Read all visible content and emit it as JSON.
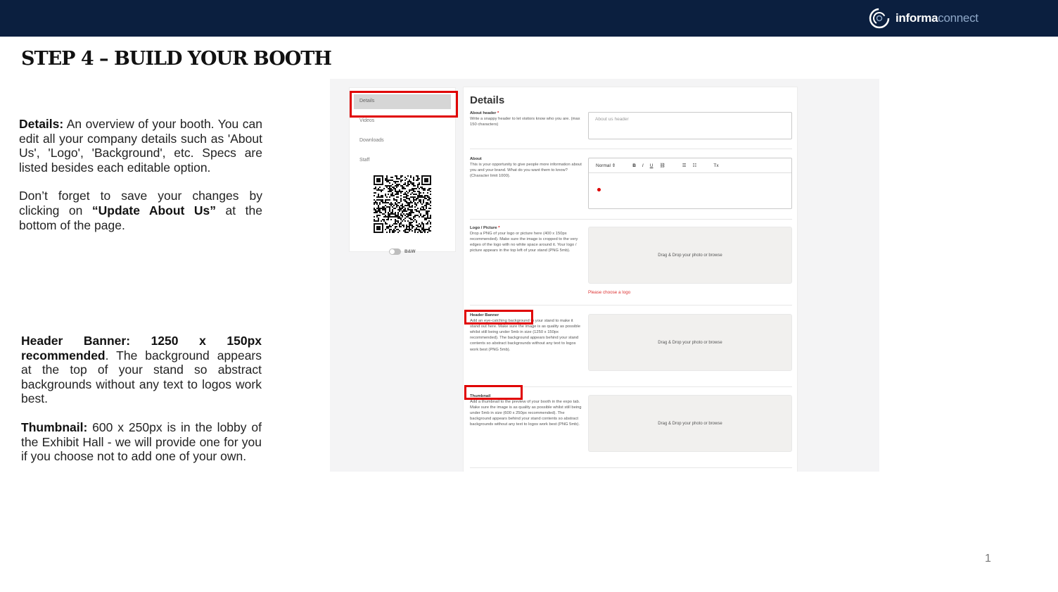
{
  "header": {
    "logo_primary": "informa",
    "logo_secondary": "connect",
    "bar_color": "#0b1f3f"
  },
  "slide": {
    "title": "STEP 4 – BUILD YOUR BOOTH",
    "page_number": "1"
  },
  "descriptions": {
    "details_label": "Details:",
    "details_text": " An overview of your booth. You can edit all your company details such as 'About Us', 'Logo', 'Background', etc. Specs are listed besides each editable option.",
    "save_pre": "Don’t forget to save your changes by clicking on ",
    "save_bold": "“Update About Us”",
    "save_post": " at the bottom of the page.",
    "banner_label": "Header Banner: 1250 x 150px recommended",
    "banner_text": ". The background appears at the top of your stand so abstract backgrounds without any text to logos work best.",
    "thumb_label": "Thumbnail:",
    "thumb_text": " 600 x 250px is in the lobby of the Exhibit Hall - we will provide one for you if you choose not to add one of your own."
  },
  "screenshot": {
    "sidebar": {
      "items": [
        "Details",
        "Videos",
        "Downloads",
        "Staff"
      ],
      "toggle_label": "B&W"
    },
    "main": {
      "title": "Details",
      "about_header": {
        "label": "About header",
        "required_mark": "*",
        "help": "Write a snappy header to let visitors know who you are. (max 150 characters)",
        "placeholder": "About us header"
      },
      "about": {
        "label": "About",
        "help": "This is your opportunity to give people more information about you and your brand. What do you want them to know? (Character limit 1000).",
        "toolbar_style": "Normal",
        "toolbar_buttons": [
          "B",
          "I",
          "U",
          "⛓",
          "☰",
          "☷",
          "Tx"
        ]
      },
      "logo": {
        "label": "Logo / Picture",
        "required_mark": "*",
        "help": "Drop a PNG of your logo or picture here (400 x 150px recommended). Make sure the image is cropped to the very edges of the logo with no white space around it. Your logo / picture appears in the top left of your stand (PNG 5mb).",
        "drop_text": "Drag & Drop your photo or browse",
        "error": "Please choose a logo"
      },
      "header_banner": {
        "label": "Header Banner",
        "help": "Add an eye-catching background to your stand to make it stand out here. Make sure the image is as quality as possible whilst still being under 5mb in size (1250 x 150px recommended). The background appears behind your stand contents so abstract backgrounds without any text to logos work best (PNG 5mb).",
        "drop_text": "Drag & Drop your photo or browse"
      },
      "thumbnail": {
        "label": "Thumbnail",
        "help": "Add a thumbnail to the preview of your booth in the expo tab. Make sure the image is as quality as possible whilst still being under 5mb in size (600 x 250px recommended). The background appears behind your stand contents so abstract backgrounds without any text to logos work best (PNG 5mb).",
        "drop_text": "Drag & Drop your photo or browse"
      }
    }
  },
  "colors": {
    "highlight": "#e00000",
    "error": "#d33333"
  }
}
